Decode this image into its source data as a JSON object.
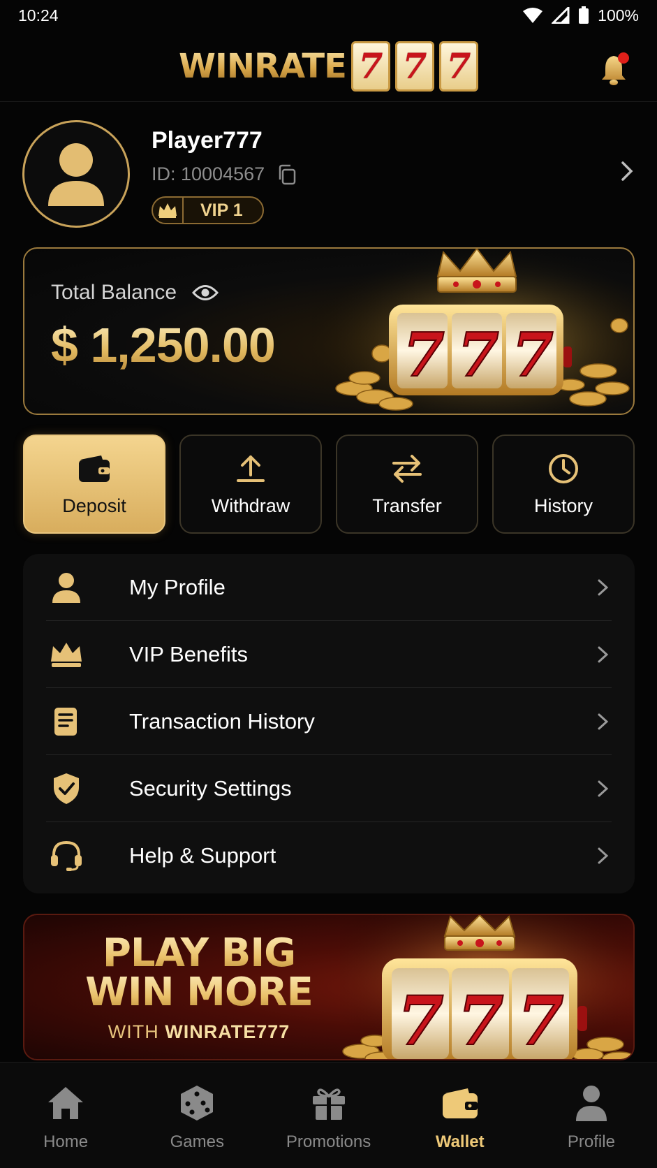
{
  "status_bar": {
    "time": "10:24",
    "battery": "100%"
  },
  "header": {
    "logo_text": "WINRATE",
    "logo_sevens": [
      "7",
      "7",
      "7"
    ]
  },
  "profile": {
    "name": "Player777",
    "id": "ID: 10004567",
    "vip": "VIP 1"
  },
  "balance": {
    "label": "Total Balance",
    "amount": "$ 1,250.00"
  },
  "actions": [
    {
      "label": "Deposit",
      "icon": "wallet-icon"
    },
    {
      "label": "Withdraw",
      "icon": "upload-icon"
    },
    {
      "label": "Transfer",
      "icon": "transfer-icon"
    },
    {
      "label": "History",
      "icon": "clock-icon"
    }
  ],
  "menu": [
    {
      "label": "My Profile",
      "icon": "person-icon"
    },
    {
      "label": "VIP Benefits",
      "icon": "crown-icon"
    },
    {
      "label": "Transaction History",
      "icon": "receipt-icon"
    },
    {
      "label": "Security Settings",
      "icon": "shield-check-icon"
    },
    {
      "label": "Help & Support",
      "icon": "headset-icon"
    }
  ],
  "promo": {
    "line1": "PLAY BIG",
    "line2": "WIN MORE",
    "line3_prefix": "WITH ",
    "line3_brand": "WINRATE777"
  },
  "nav": [
    {
      "label": "Home",
      "icon": "home-icon"
    },
    {
      "label": "Games",
      "icon": "dice-icon"
    },
    {
      "label": "Promotions",
      "icon": "gift-icon"
    },
    {
      "label": "Wallet",
      "icon": "wallet-icon",
      "active": true
    },
    {
      "label": "Profile",
      "icon": "person-icon"
    }
  ],
  "colors": {
    "accent_gold": "#e6c177",
    "background": "#050505",
    "notification_dot": "#e0201a",
    "seven_red": "#c8141b"
  }
}
